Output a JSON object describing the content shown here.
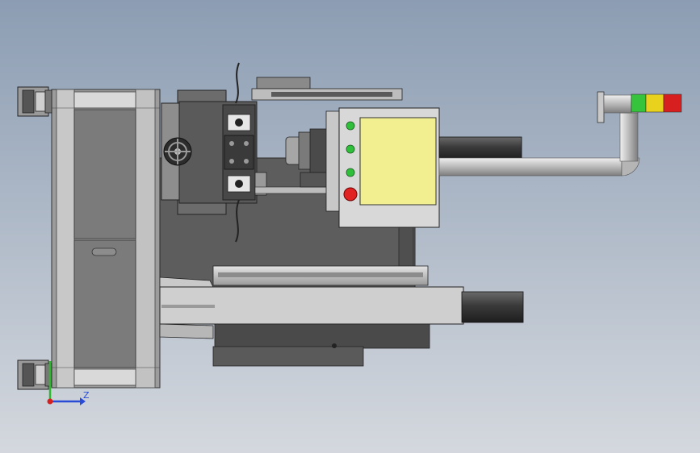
{
  "viewport": {
    "background_top": "#8c9db3",
    "background_bottom": "#d4d8de"
  },
  "colors": {
    "steel_light": "#d6d6d6",
    "steel_mid": "#a9a9a9",
    "steel_dark": "#6e6e6e",
    "frame_gray": "#8a8a8a",
    "cabinet": "#5d5d5d",
    "dark_block": "#3c3c3c",
    "screen_yellow": "#f2ef91",
    "indicator_green": "#2fbf3a",
    "indicator_red": "#e02222",
    "tower_green": "#35c43c",
    "tower_yellow": "#e8d21e",
    "tower_red": "#d81f1f",
    "axis_z": "#2a4bd6",
    "axis_y": "#2fb82f",
    "axis_origin": "#d42020"
  },
  "axis_triad": {
    "z_label": "Z"
  }
}
